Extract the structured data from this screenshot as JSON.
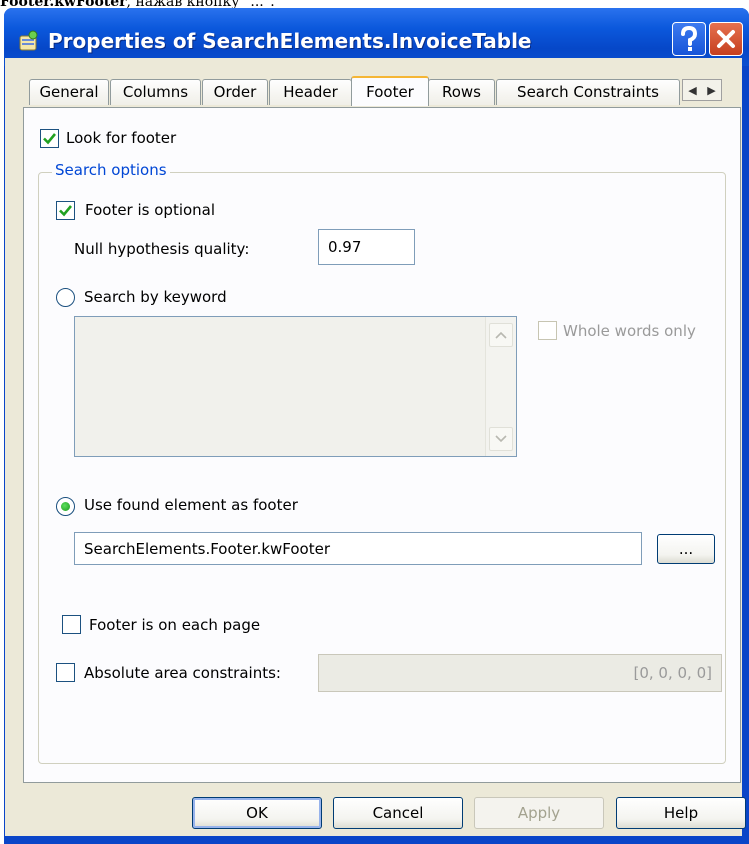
{
  "caption": {
    "bold_text": "Footer.kwFooter",
    "rest_text": ", нажав кнопку \"...\"."
  },
  "window": {
    "title": "Properties of SearchElements.InvoiceTable"
  },
  "tabs": [
    {
      "label": "General"
    },
    {
      "label": "Columns"
    },
    {
      "label": "Order"
    },
    {
      "label": "Header"
    },
    {
      "label": "Footer"
    },
    {
      "label": "Rows"
    },
    {
      "label": "Search Constraints"
    }
  ],
  "active_tab": "Footer",
  "footer_page": {
    "look_for_footer": {
      "label": "Look for footer",
      "checked": true
    },
    "search_options": {
      "title": "Search options",
      "footer_optional": {
        "label": "Footer is optional",
        "checked": true
      },
      "null_hypothesis": {
        "label": "Null hypothesis quality:",
        "value": "0.97"
      },
      "search_by_keyword": {
        "label": "Search by keyword",
        "selected": false
      },
      "whole_words_only": {
        "label": "Whole words only",
        "checked": false,
        "enabled": false
      },
      "use_found_element": {
        "label": "Use found element as footer",
        "selected": true
      },
      "found_element": {
        "value": "SearchElements.Footer.kwFooter",
        "browse_label": "..."
      },
      "footer_each_page": {
        "label": "Footer is on each page",
        "checked": false
      },
      "absolute_area": {
        "label": "Absolute area constraints:",
        "checked": false,
        "value": "[0, 0, 0, 0]"
      }
    }
  },
  "buttons": {
    "ok": "OK",
    "cancel": "Cancel",
    "apply": "Apply",
    "help": "Help"
  },
  "colors": {
    "titlebar": "#0a4fd0",
    "accent_check": "#21a121",
    "group_title": "#0046d5"
  }
}
